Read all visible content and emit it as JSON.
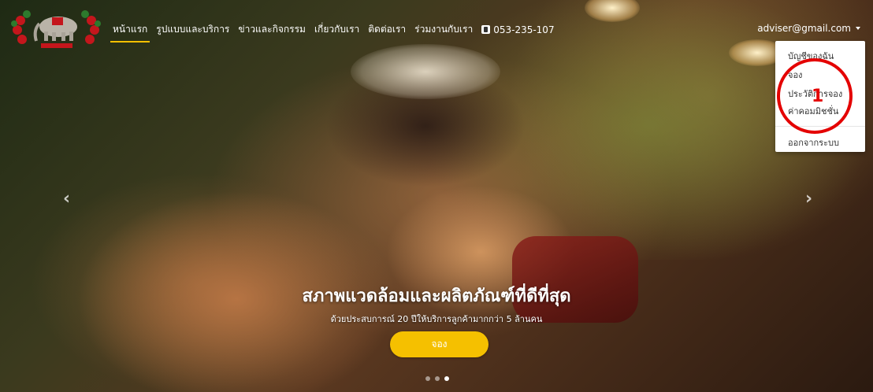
{
  "nav": {
    "links": [
      "หน้าแรก",
      "รูปแบบและบริการ",
      "ข่าวและกิจกรรม",
      "เกี่ยวกับเรา",
      "ติดต่อเรา",
      "ร่วมงานกับเรา"
    ],
    "phone": "053-235-107",
    "user_email": "adviser@gmail.com"
  },
  "dropdown": {
    "items": [
      "บัญชีของฉัน",
      "จอง",
      "ประวัติการจอง",
      "ค่าคอมมิชชั่น"
    ],
    "logout": "ออกจากระบบ"
  },
  "annotation": {
    "number": "1"
  },
  "hero": {
    "title": "สภาพแวดล้อมและผลิตภัณฑ์ที่ดีที่สุด",
    "subtitle": "ด้วยประสบการณ์ 20 ปีให้บริการลูกค้ามากกว่า 5 ล้านคน",
    "button": "จอง",
    "prev_icon": "chevron-left-icon",
    "next_icon": "chevron-right-icon",
    "slides_total": 3,
    "slide_active": 3
  },
  "colors": {
    "accent": "#f5c000",
    "annotation": "#e40000"
  }
}
